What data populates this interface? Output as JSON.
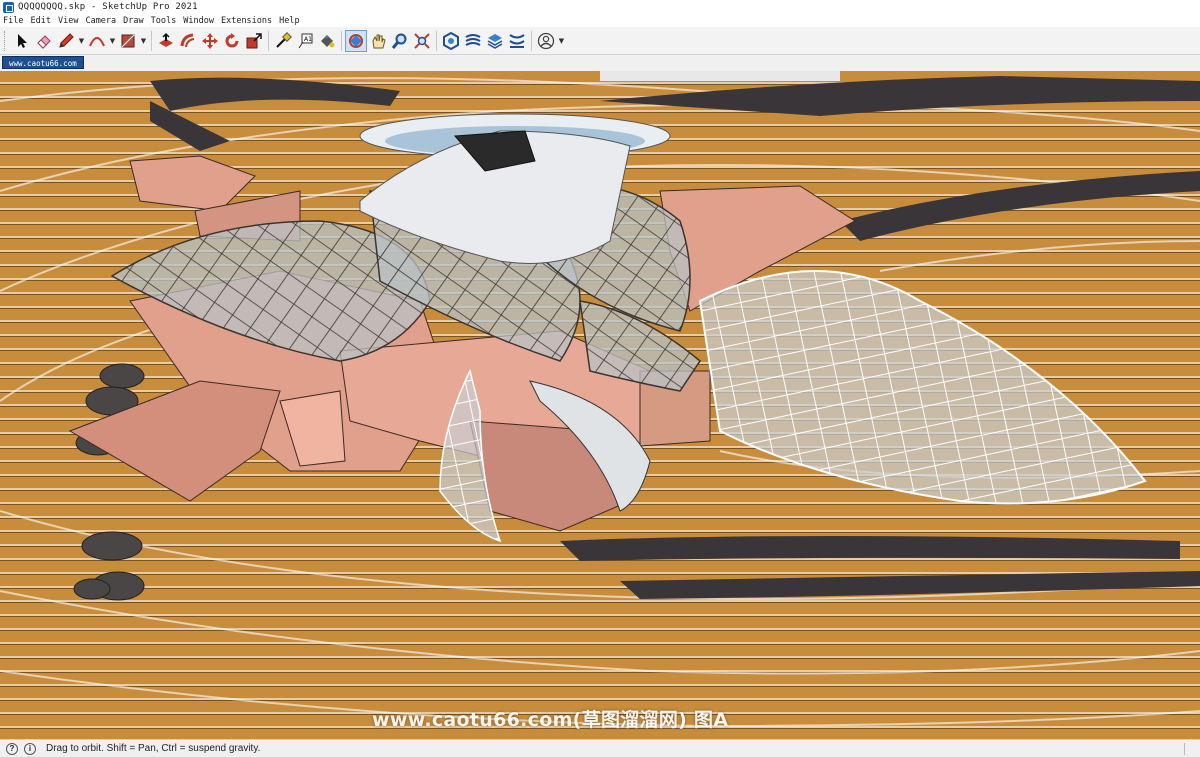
{
  "window": {
    "title": "QQQQQQQQ.skp - SketchUp Pro 2021"
  },
  "menu": {
    "items": [
      "File",
      "Edit",
      "View",
      "Camera",
      "Draw",
      "Tools",
      "Window",
      "Extensions",
      "Help"
    ]
  },
  "toolbar": {
    "tools": [
      {
        "name": "select-icon",
        "active": false
      },
      {
        "name": "eraser-icon",
        "active": false
      },
      {
        "name": "pencil-icon",
        "active": false,
        "dropdown": true
      },
      {
        "name": "arc-icon",
        "active": false,
        "dropdown": true
      },
      {
        "name": "rectangle-icon",
        "active": false,
        "dropdown": true
      },
      {
        "name": "push-pull-icon",
        "active": false
      },
      {
        "name": "offset-icon",
        "active": false
      },
      {
        "name": "move-icon",
        "active": false
      },
      {
        "name": "rotate-icon",
        "active": false
      },
      {
        "name": "scale-icon",
        "active": false
      },
      {
        "name": "tape-measure-icon",
        "active": false
      },
      {
        "name": "text-icon",
        "active": false
      },
      {
        "name": "paint-bucket-icon",
        "active": false
      },
      {
        "name": "orbit-icon",
        "active": true
      },
      {
        "name": "pan-icon",
        "active": false
      },
      {
        "name": "zoom-icon",
        "active": false
      },
      {
        "name": "zoom-extents-icon",
        "active": false
      },
      {
        "name": "warehouse-icon",
        "active": false
      },
      {
        "name": "extension-warehouse-icon",
        "active": false
      },
      {
        "name": "layout-icon",
        "active": false
      },
      {
        "name": "extension-manager-icon",
        "active": false
      },
      {
        "name": "profile-icon",
        "active": false,
        "dropdown": true
      }
    ]
  },
  "scene": {
    "tab_label": "www.caotu66.com"
  },
  "watermark": {
    "text": "www.caotu66.com(草图溜溜网) 图A"
  },
  "status": {
    "text": "Drag to orbit. Shift = Pan, Ctrl = suspend gravity."
  },
  "colors": {
    "terrain": "#c88d3c",
    "terrain_dark": "#3a3538",
    "roof_pink": "#e0a08c",
    "glass": "#b9c2c6",
    "accent_blue": "#1f4f8f"
  }
}
